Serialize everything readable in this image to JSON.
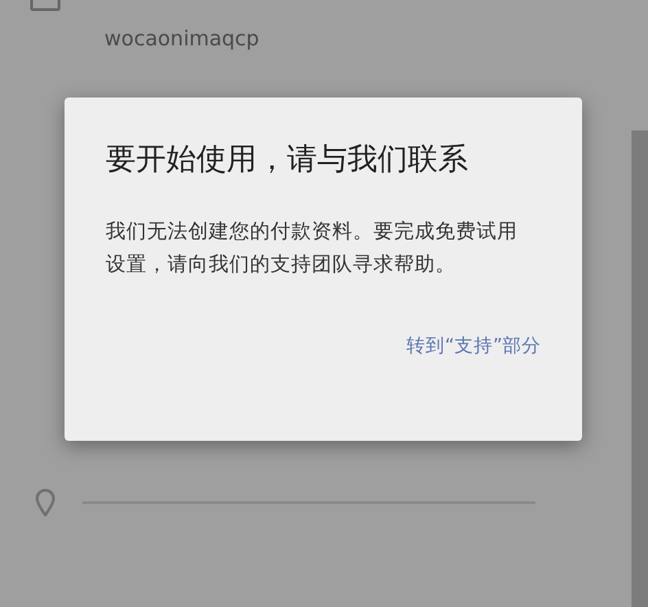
{
  "background": {
    "account_name": "wocaonimaqcp"
  },
  "dialog": {
    "title": "要开始使用，请与我们联系",
    "message": "我们无法创建您的付款资料。要完成免费试用设置，请向我们的支持团队寻求帮助。",
    "action": "转到“支持”部分"
  }
}
